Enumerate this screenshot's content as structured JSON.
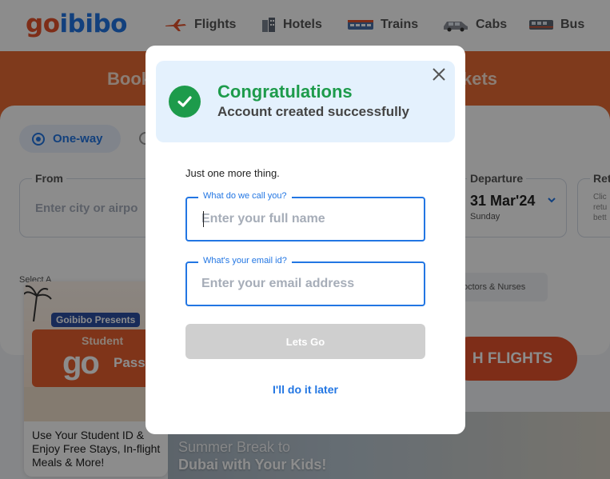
{
  "background": {
    "logo": {
      "part1": "go",
      "part2": "ibibo"
    },
    "nav": [
      {
        "label": "Flights",
        "icon": "plane-icon"
      },
      {
        "label": "Hotels",
        "icon": "hotel-icon"
      },
      {
        "label": "Trains",
        "icon": "train-icon"
      },
      {
        "label": "Cabs",
        "icon": "car-icon"
      },
      {
        "label": "Bus",
        "icon": "bus-icon"
      }
    ],
    "hero_title_left": "Book",
    "hero_title_right": "kets",
    "trip_type": {
      "selected": "One-way"
    },
    "from": {
      "label": "From",
      "placeholder": "Enter city or airpo"
    },
    "departure": {
      "label": "Departure",
      "date": "31 Mar'24",
      "day": "Sunday"
    },
    "return_label": "Ret",
    "return_hint": "Clic retu bett",
    "select_a": "Select A",
    "special_fare_chip": "octors & Nurses",
    "search_button": "H FLIGHTS",
    "promo": {
      "tag": "Goibibo Presents",
      "student": "Student",
      "go": "go",
      "pass": "Pass",
      "text": "Use Your Student ID & Enjoy Free Stays, In-flight Meals & More!"
    },
    "beach_promo": {
      "line1": "Summer Break to",
      "line2": "Dubai with Your Kids!"
    }
  },
  "modal": {
    "title": "Congratulations",
    "subtitle": "Account created successfully",
    "prompt": "Just one more thing.",
    "name_field": {
      "label": "What do we call you?",
      "placeholder": "Enter your full name",
      "value": ""
    },
    "email_field": {
      "label": "What's your email id?",
      "placeholder": "Enter your email address",
      "value": ""
    },
    "submit_label": "Lets Go",
    "later_label": "I'll do it later"
  },
  "colors": {
    "brand_orange": "#e5532c",
    "brand_blue": "#2276e3",
    "success_green": "#1d9b4b",
    "banner_bg": "#e4f1fd",
    "disabled_button": "#cfcfcf"
  }
}
